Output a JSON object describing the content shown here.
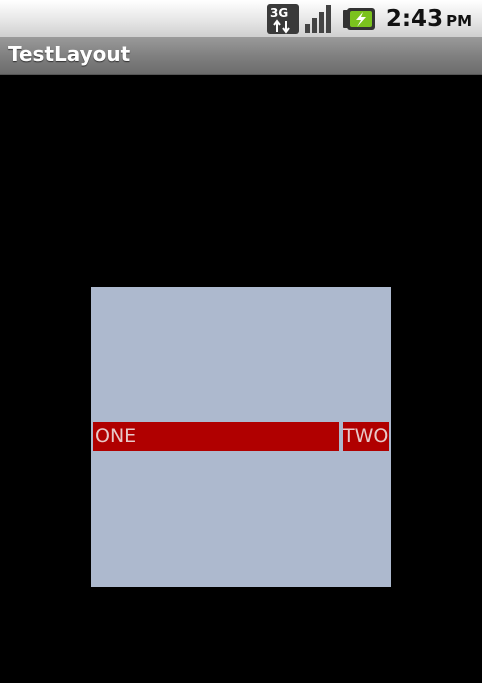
{
  "status_bar": {
    "network_type": "3G",
    "time": "2:43",
    "ampm": "PM"
  },
  "title_bar": {
    "title": "TestLayout"
  },
  "layout": {
    "label_one": "ONE",
    "label_two": "TWO"
  },
  "colors": {
    "background": "#000000",
    "layout_box": "#adb9ce",
    "label_background": "#b00000",
    "label_text": "#e8c8c8"
  }
}
